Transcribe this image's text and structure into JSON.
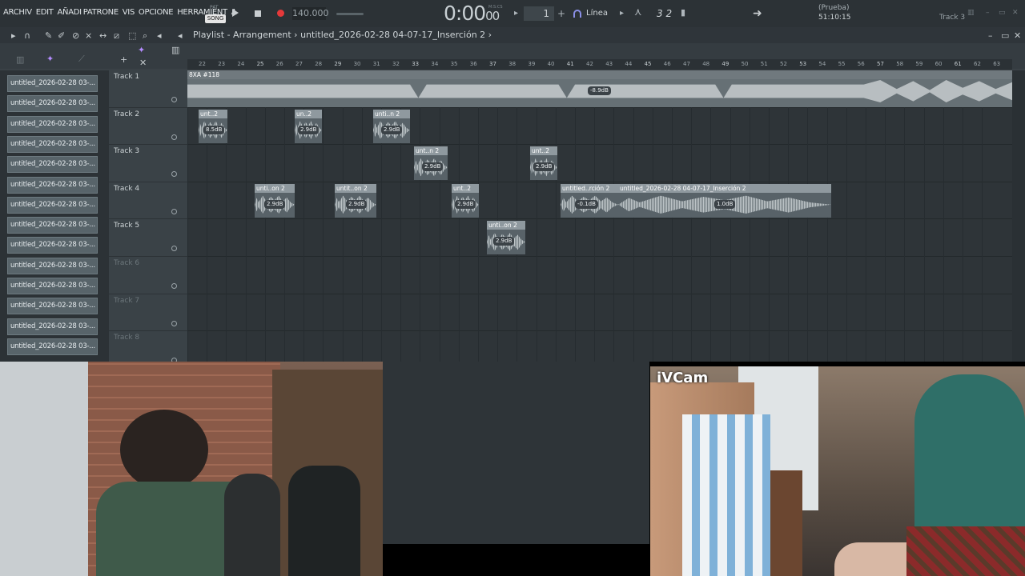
{
  "menu": {
    "items": [
      "ARCHIV",
      "EDIT",
      "AÑADI",
      "PATRONE",
      "VIS",
      "OPCIONE",
      "HERRAMIENT",
      "A"
    ]
  },
  "transport": {
    "pattern_label": "PAT",
    "song_label": "SONG",
    "tempo": "140.000",
    "time": "0:00",
    "time_ms": "00",
    "time_unit": "M:S:CS",
    "pattern_number": "1",
    "snap": "Línea",
    "beat_subdiv": "3 2"
  },
  "hint": {
    "line1": "(Prueba)",
    "line2": "51:10:15"
  },
  "top_track_name": "Track 3",
  "playlist": {
    "title": "Playlist - Arrangement",
    "project": "untitled_2026-02-28 04-07-17_Inserción 2",
    "bars": [
      "22",
      "23",
      "24",
      "25",
      "26",
      "27",
      "28",
      "29",
      "30",
      "31",
      "32",
      "33",
      "34",
      "35",
      "36",
      "37",
      "38",
      "39",
      "40",
      "41",
      "42",
      "43",
      "44",
      "45",
      "46",
      "47",
      "48",
      "49",
      "50",
      "51",
      "52",
      "53",
      "54",
      "55",
      "56",
      "57",
      "58",
      "59",
      "60",
      "61",
      "62",
      "63"
    ]
  },
  "picker": {
    "items": [
      "untitled_2026-02-28 03-...",
      "untitled_2026-02-28 03-...",
      "untitled_2026-02-28 03-...",
      "untitled_2026-02-28 03-...",
      "untitled_2026-02-28 03-...",
      "untitled_2026-02-28 03-...",
      "untitled_2026-02-28 03-...",
      "untitled_2026-02-28 03-...",
      "untitled_2026-02-28 03-...",
      "untitled_2026-02-28 03-...",
      "untitled_2026-02-28 03-...",
      "untitled_2026-02-28 03-...",
      "untitled_2026-02-28 03-...",
      "untitled_2026-02-28 03-..."
    ]
  },
  "tracks": [
    {
      "name": "Track 1"
    },
    {
      "name": "Track 2"
    },
    {
      "name": "Track 3"
    },
    {
      "name": "Track 4"
    },
    {
      "name": "Track 5"
    },
    {
      "name": "Track 6"
    },
    {
      "name": "Track 7"
    },
    {
      "name": "Track 8"
    }
  ],
  "clips": {
    "t1": {
      "name": "8XA #118",
      "db": "-8.9dB"
    },
    "t2": [
      {
        "name": "unt..2",
        "db": "8.5dB"
      },
      {
        "name": "un..2",
        "db": "2.9dB"
      },
      {
        "name": "unti..n 2",
        "db": "2.9dB"
      }
    ],
    "t3": [
      {
        "name": "unt..n 2",
        "db": "2.9dB"
      },
      {
        "name": "unt..2",
        "db": "2.9dB"
      }
    ],
    "t4": [
      {
        "name": "unti..on 2",
        "db": "2.9dB"
      },
      {
        "name": "untit..on 2",
        "db": "2.9dB"
      },
      {
        "name": "unt..2",
        "db": "2.9dB"
      },
      {
        "name": "untitled..rción 2",
        "db": "-0.1dB"
      },
      {
        "name": "untitled_2026-02-28 04-07-17_Inserción 2",
        "db": "1.0dB"
      }
    ],
    "t5": [
      {
        "name": "unti..on 2",
        "db": "2.9dB"
      }
    ]
  },
  "webcam": {
    "label": "iVCam"
  },
  "colors": {
    "rec": "#e5393a",
    "accent": "#8a8fe6"
  }
}
